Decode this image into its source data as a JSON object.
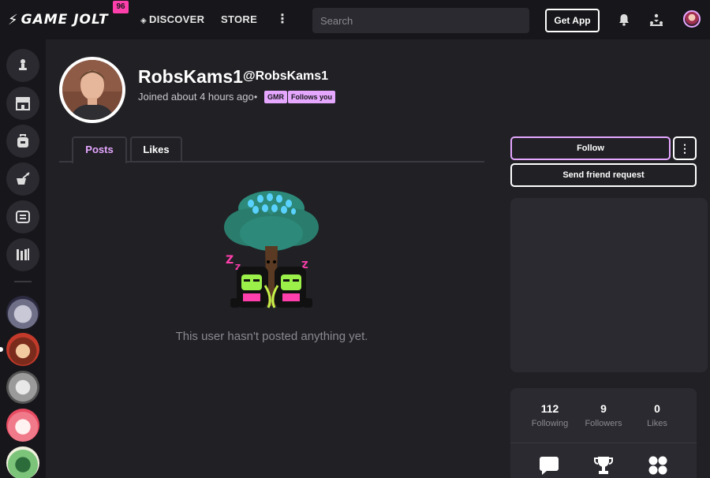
{
  "topbar": {
    "logo_text": "GAME JOLT",
    "logo_badge": "96",
    "nav_discover": "DISCOVER",
    "nav_store": "STORE",
    "nav_more": "⋮",
    "search_placeholder": "Search",
    "get_app": "Get App"
  },
  "profile": {
    "display_name": "RobsKams1",
    "handle": "@RobsKams1",
    "joined": "Joined about 4 hours ago",
    "separator": "•",
    "tags": [
      "GMR",
      "Follows you"
    ]
  },
  "tabs": [
    {
      "label": "Posts",
      "active": true
    },
    {
      "label": "Likes",
      "active": false
    }
  ],
  "empty_state": {
    "message": "This user hasn't posted anything yet."
  },
  "actions": {
    "follow": "Follow",
    "more": "⋮",
    "friend_request": "Send friend request"
  },
  "stats": [
    {
      "value": "112",
      "label": "Following"
    },
    {
      "value": "9",
      "label": "Followers"
    },
    {
      "value": "0",
      "label": "Likes"
    }
  ],
  "stat_icons": [
    "chat-icon",
    "trophy-icon",
    "four-dots-icon"
  ],
  "sidebar_icons": [
    "game-controller-icon",
    "store-icon",
    "backpack-icon",
    "quest-icon",
    "news-icon",
    "library-icon"
  ],
  "colors": {
    "accent": "#e5a7ff",
    "brand_pink": "#ff3fac",
    "background": "#212025",
    "topbar": "#17161a",
    "panel": "#2b2a30"
  }
}
